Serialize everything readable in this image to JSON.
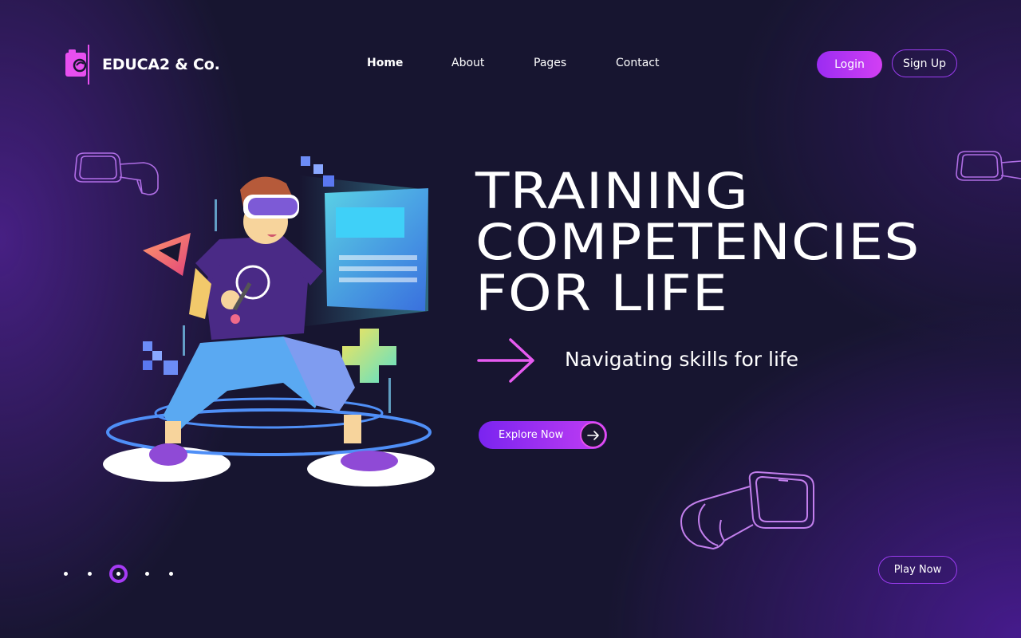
{
  "brand": {
    "name": "EDUCA2 & Co."
  },
  "nav": {
    "items": [
      {
        "label": "Home",
        "active": true
      },
      {
        "label": "About",
        "active": false
      },
      {
        "label": "Pages",
        "active": false
      },
      {
        "label": "Contact",
        "active": false
      }
    ]
  },
  "header": {
    "login_label": "Login",
    "signup_label": "Sign Up"
  },
  "hero": {
    "headline_lines": [
      "TRAINING",
      "COMPETENCIES",
      "FOR LIFE"
    ],
    "subline": "Navigating skills for life",
    "explore_label": "Explore Now",
    "play_label": "Play Now"
  },
  "pagination": {
    "total": 5,
    "active_index": 2
  },
  "colors": {
    "background": "#171530",
    "accent_purple": "#9b2cf2",
    "accent_pink": "#e64ff0",
    "text": "#ffffff"
  },
  "icons": [
    "logo-icon",
    "arrow-right-icon",
    "vr-headset-icon"
  ]
}
